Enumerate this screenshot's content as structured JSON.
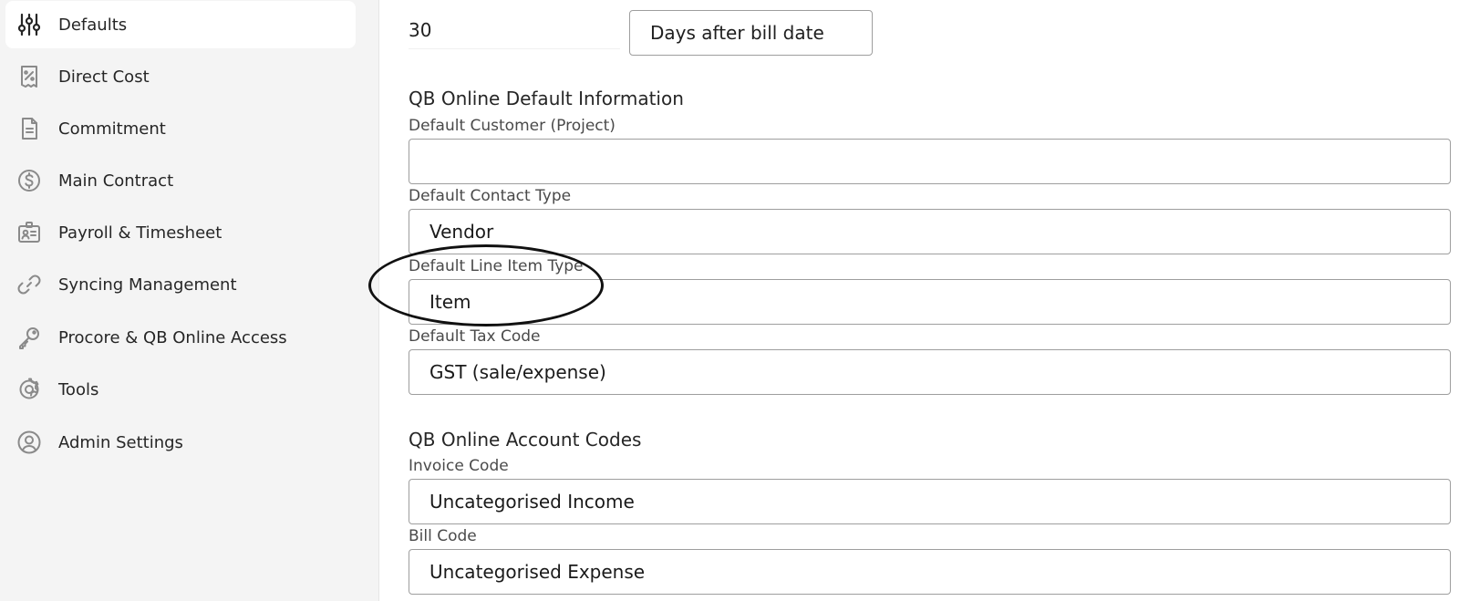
{
  "sidebar": {
    "items": [
      {
        "label": "Defaults",
        "icon": "sliders-icon",
        "active": true
      },
      {
        "label": "Direct Cost",
        "icon": "receipt-percent-icon"
      },
      {
        "label": "Commitment",
        "icon": "document-icon"
      },
      {
        "label": "Main Contract",
        "icon": "dollar-circle-icon"
      },
      {
        "label": "Payroll & Timesheet",
        "icon": "id-badge-icon"
      },
      {
        "label": "Syncing Management",
        "icon": "link-icon"
      },
      {
        "label": "Procore & QB Online Access",
        "icon": "key-icon"
      },
      {
        "label": "Tools",
        "icon": "gear-icon"
      },
      {
        "label": "Admin Settings",
        "icon": "user-circle-icon"
      }
    ]
  },
  "payment_terms": {
    "value": "30",
    "unit": "Days after bill date"
  },
  "qb_default": {
    "title": "QB Online Default Information",
    "customer_label": "Default Customer (Project)",
    "customer_value": "",
    "contact_type_label": "Default Contact Type",
    "contact_type_value": "Vendor",
    "line_item_label": "Default Line Item Type",
    "line_item_value": "Item",
    "tax_code_label": "Default Tax Code",
    "tax_code_value": "GST (sale/expense)"
  },
  "qb_accounts": {
    "title": "QB Online Account Codes",
    "invoice_label": "Invoice Code",
    "invoice_value": "Uncategorised Income",
    "bill_label": "Bill Code",
    "bill_value": "Uncategorised Expense"
  },
  "colors": {
    "sidebar_bg": "#f4f4f4",
    "active_item_bg": "#ffffff",
    "icon_color": "#8a8a8a",
    "active_icon_color": "#262626",
    "field_border": "#9e9e9e"
  }
}
